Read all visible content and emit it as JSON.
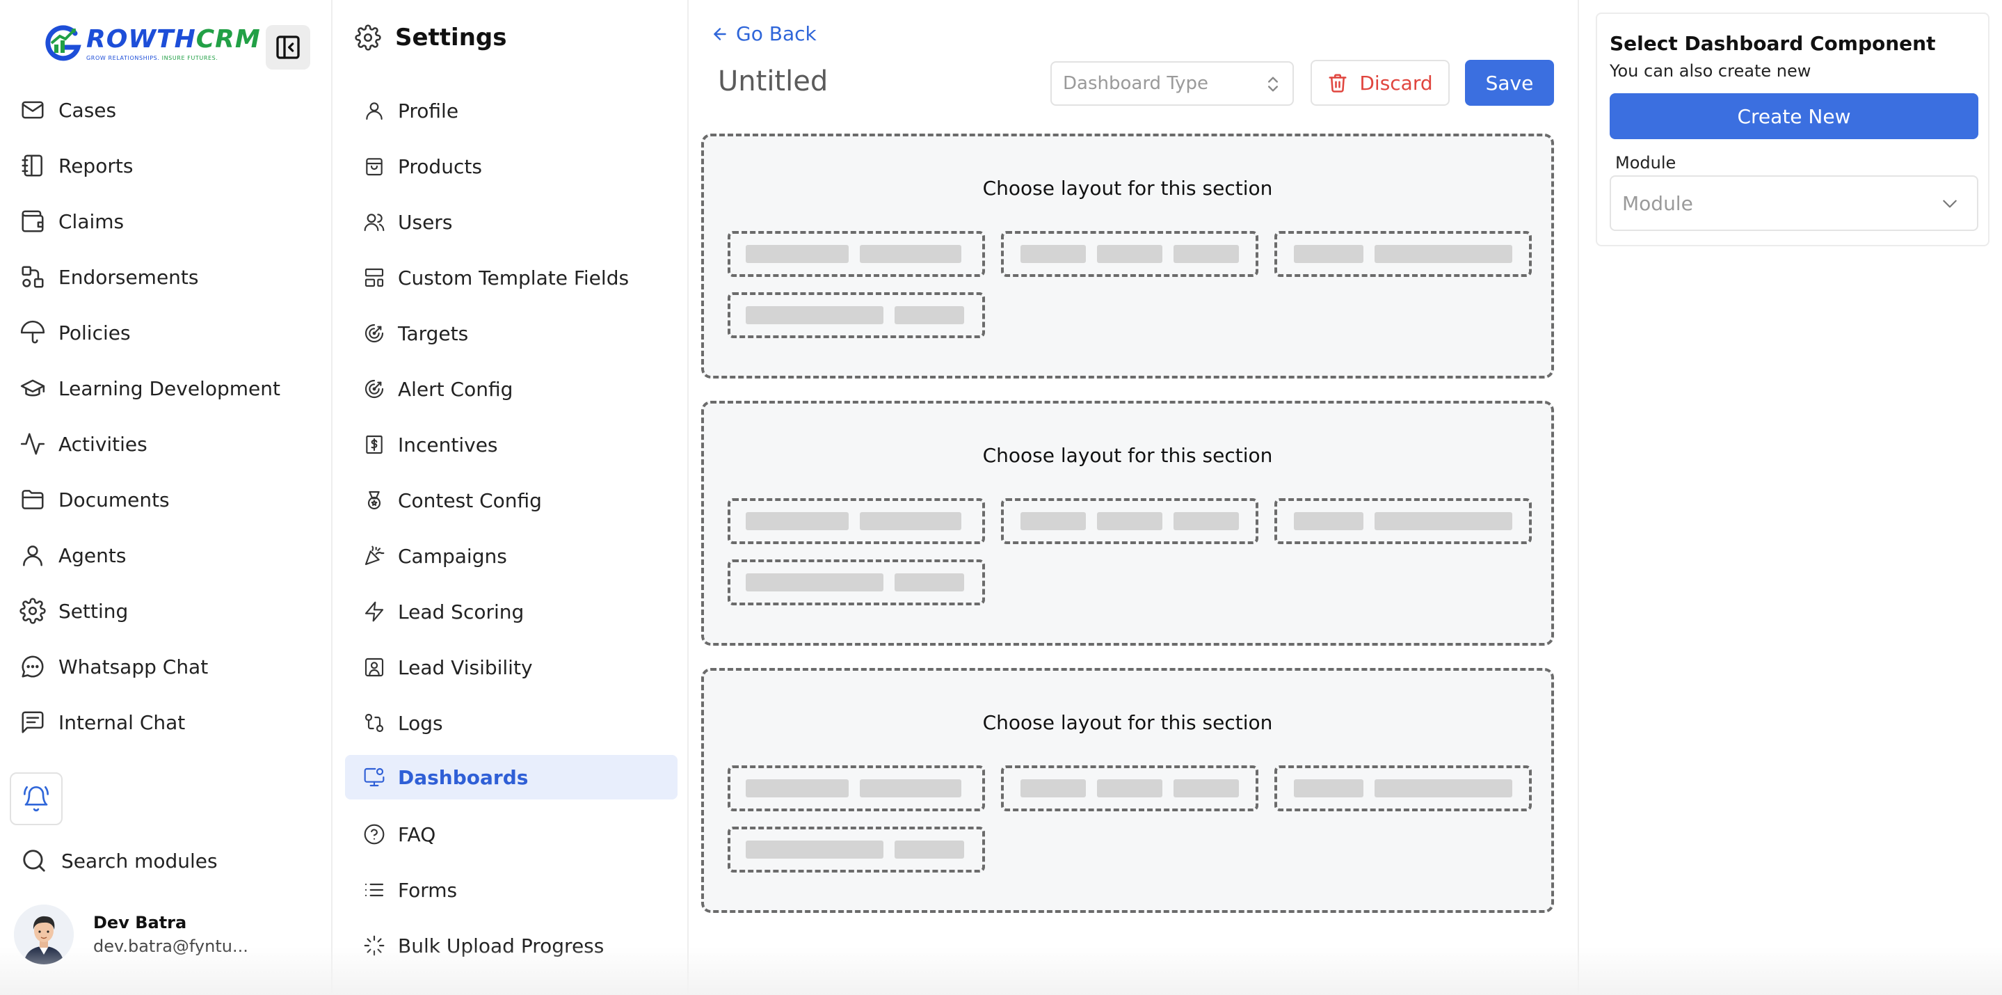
{
  "app": {
    "logo_name_left": "ROWTH",
    "logo_name_right": "CRM",
    "logo_tag_left": "GROW RELATIONSHIPS.",
    "logo_tag_right": "INSURE FUTURES.",
    "brand_blue": "#1d4ed8",
    "brand_green": "#22a046"
  },
  "left_nav": {
    "items": [
      {
        "label": "Cases",
        "icon": "mail-icon"
      },
      {
        "label": "Reports",
        "icon": "notebook-icon"
      },
      {
        "label": "Claims",
        "icon": "wallet-icon"
      },
      {
        "label": "Endorsements",
        "icon": "shapes-icon"
      },
      {
        "label": "Policies",
        "icon": "umbrella-icon"
      },
      {
        "label": "Learning Development",
        "icon": "graduation-cap-icon"
      },
      {
        "label": "Activities",
        "icon": "activity-icon"
      },
      {
        "label": "Documents",
        "icon": "folder-icon"
      },
      {
        "label": "Agents",
        "icon": "user-icon"
      },
      {
        "label": "Setting",
        "icon": "gear-icon"
      },
      {
        "label": "Whatsapp Chat",
        "icon": "chat-bubble-icon"
      },
      {
        "label": "Internal Chat",
        "icon": "message-square-icon"
      }
    ],
    "search_label": "Search modules",
    "user": {
      "name": "Dev Batra",
      "email": "dev.batra@fyntu..."
    }
  },
  "settings_nav": {
    "title": "Settings",
    "items": [
      {
        "label": "Profile",
        "icon": "user-icon"
      },
      {
        "label": "Products",
        "icon": "shopping-bag-icon"
      },
      {
        "label": "Users",
        "icon": "users-icon"
      },
      {
        "label": "Custom Template Fields",
        "icon": "layout-template-icon"
      },
      {
        "label": "Targets",
        "icon": "target-icon"
      },
      {
        "label": "Alert Config",
        "icon": "target-icon"
      },
      {
        "label": "Incentives",
        "icon": "receipt-dollar-icon"
      },
      {
        "label": "Contest Config",
        "icon": "medal-icon"
      },
      {
        "label": "Campaigns",
        "icon": "party-popper-icon"
      },
      {
        "label": "Lead Scoring",
        "icon": "zap-icon"
      },
      {
        "label": "Lead Visibility",
        "icon": "user-square-icon"
      },
      {
        "label": "Logs",
        "icon": "git-compare-icon"
      },
      {
        "label": "Dashboards",
        "icon": "monitor-settings-icon",
        "active": true
      },
      {
        "label": "FAQ",
        "icon": "help-circle-icon"
      },
      {
        "label": "Forms",
        "icon": "list-icon"
      },
      {
        "label": "Bulk Upload Progress",
        "icon": "loader-icon"
      }
    ]
  },
  "editor": {
    "go_back": "Go Back",
    "title": "Untitled",
    "dashboard_type_placeholder": "Dashboard Type",
    "discard_label": "Discard",
    "save_label": "Save",
    "sections": [
      {
        "title": "Choose layout for this section"
      },
      {
        "title": "Choose layout for this section"
      },
      {
        "title": "Choose layout for this section"
      }
    ],
    "accent": "#3b6fe0",
    "danger": "#e0453e"
  },
  "right_panel": {
    "title": "Select Dashboard Component",
    "subtitle": "You can also create new",
    "create_label": "Create New",
    "module_label": "Module",
    "module_placeholder": "Module"
  }
}
